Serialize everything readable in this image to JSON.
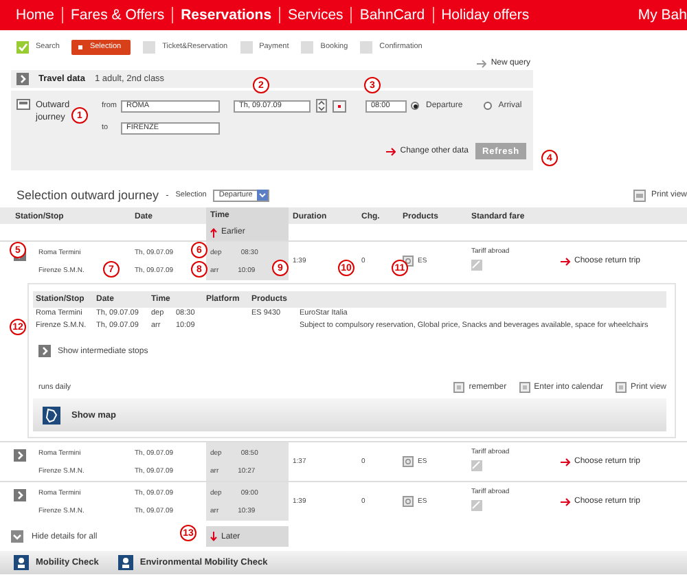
{
  "nav": {
    "items": [
      {
        "label": "Home",
        "selected": false
      },
      {
        "label": "Fares & Offers",
        "selected": false
      },
      {
        "label": "Reservations",
        "selected": true
      },
      {
        "label": "Services",
        "selected": false
      },
      {
        "label": "BahnCard",
        "selected": false
      },
      {
        "label": "Holiday offers",
        "selected": false
      }
    ],
    "account": "My Bah"
  },
  "steps": [
    {
      "label": "Search",
      "checked": true,
      "selected": false
    },
    {
      "label": "Selection",
      "checked": false,
      "selected": true
    },
    {
      "label": "Ticket&Reservation",
      "checked": false,
      "selected": false
    },
    {
      "label": "Payment",
      "checked": false,
      "selected": false
    },
    {
      "label": "Booking",
      "checked": false,
      "selected": false
    },
    {
      "label": "Confirmation",
      "checked": false,
      "selected": false
    }
  ],
  "new_query": "New query",
  "travel_data": {
    "title": "Travel data",
    "summary": "1 adult, 2nd class"
  },
  "journey": {
    "title": "Outward journey",
    "from_label": "from",
    "from": "ROMA",
    "to_label": "to",
    "to": "FIRENZE",
    "date": "Th, 09.07.09",
    "time": "08:00",
    "modes": [
      {
        "label": "Departure",
        "selected": true
      },
      {
        "label": "Arrival",
        "selected": false
      }
    ],
    "change_link": "Change other data",
    "refresh": "Refresh"
  },
  "selection": {
    "title": "Selection outward journey",
    "dash": "-",
    "label": "Selection",
    "value": "Departure",
    "print": "Print view"
  },
  "columns": [
    "Station/Stop",
    "Date",
    "Time",
    "Duration",
    "Chg.",
    "Products",
    "Standard fare"
  ],
  "earlier": "Earlier",
  "connections": [
    {
      "from": "Roma Termini",
      "to": "Firenze S.M.N.",
      "dep_date": "Th, 09.07.09",
      "arr_date": "Th, 09.07.09",
      "dep_label": "dep",
      "dep": "08:30",
      "arr_label": "arr",
      "arr": "10:09",
      "duration": "1:39",
      "changes": "0",
      "product": "ES",
      "fare": "Tariff abroad",
      "action": "Choose return trip",
      "expanded": true
    },
    {
      "from": "Roma Termini",
      "to": "Firenze S.M.N.",
      "dep_date": "Th, 09.07.09",
      "arr_date": "Th, 09.07.09",
      "dep_label": "dep",
      "dep": "08:50",
      "arr_label": "arr",
      "arr": "10:27",
      "duration": "1:37",
      "changes": "0",
      "product": "ES",
      "fare": "Tariff abroad",
      "action": "Choose return trip",
      "expanded": false
    },
    {
      "from": "Roma Termini",
      "to": "Firenze S.M.N.",
      "dep_date": "Th, 09.07.09",
      "arr_date": "Th, 09.07.09",
      "dep_label": "dep",
      "dep": "09:00",
      "arr_label": "arr",
      "arr": "10:39",
      "duration": "1:39",
      "changes": "0",
      "product": "ES",
      "fare": "Tariff abroad",
      "action": "Choose return trip",
      "expanded": false
    }
  ],
  "details": {
    "columns": [
      "Station/Stop",
      "Date",
      "Time",
      "Platform",
      "Products"
    ],
    "rows": [
      {
        "station": "Roma Termini",
        "date": "Th, 09.07.09",
        "kind": "dep",
        "time": "08:30",
        "product": "ES 9430",
        "info": "EuroStar Italia"
      },
      {
        "station": "Firenze S.M.N.",
        "date": "Th, 09.07.09",
        "kind": "arr",
        "time": "10:09",
        "info": "Subject to compulsory reservation, Global price, Snacks and beverages available, space for wheelchairs"
      }
    ],
    "intermediate": "Show intermediate stops",
    "runs": "runs daily",
    "actions": [
      "remember",
      "Enter into calendar",
      "Print view"
    ],
    "map": "Show map"
  },
  "hide_details": "Hide details for all",
  "later": "Later",
  "footer": [
    "Mobility Check",
    "Environmental Mobility Check"
  ],
  "markers": [
    "1",
    "2",
    "3",
    "4",
    "5",
    "6",
    "7",
    "8",
    "9",
    "10",
    "11",
    "12",
    "13"
  ]
}
